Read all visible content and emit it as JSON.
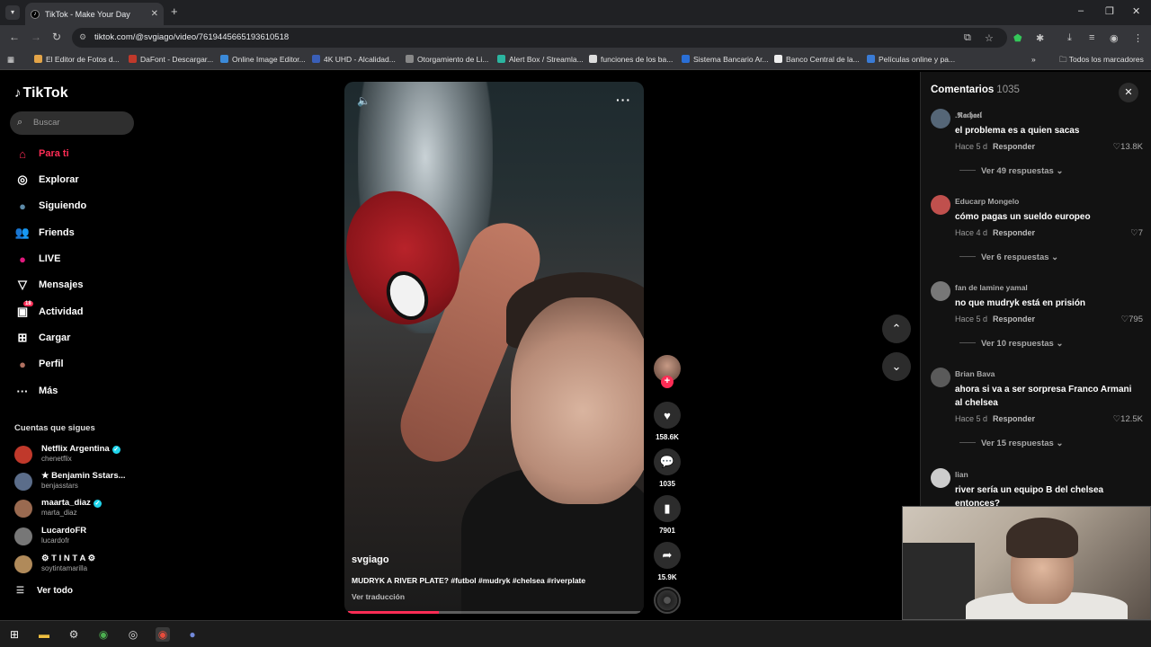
{
  "browser": {
    "tab_title": "TikTok - Make Your Day",
    "url": "tiktok.com/@svgiago/video/7619445665193610518",
    "bookmarks": [
      {
        "label": "El Editor de Fotos d...",
        "color": "#e3a448"
      },
      {
        "label": "DaFont - Descargar...",
        "color": "#c0392b"
      },
      {
        "label": "Online Image Editor...",
        "color": "#3b8ad9"
      },
      {
        "label": "4K UHD - Alcalidad...",
        "color": "#3a5fb8"
      },
      {
        "label": "Otorgamiento de Li...",
        "color": "#888888"
      },
      {
        "label": "Alert Box / Streamla...",
        "color": "#2bb5a0"
      },
      {
        "label": "funciones de los ba...",
        "color": "#dddddd"
      },
      {
        "label": "Sistema Bancario Ar...",
        "color": "#2a6fd6"
      },
      {
        "label": "Banco Central de la...",
        "color": "#eeeeee"
      },
      {
        "label": "Películas online y pa...",
        "color": "#3a7bd5"
      }
    ],
    "all_bookmarks": "Todos los marcadores"
  },
  "sidebar": {
    "logo": "TikTok",
    "search_placeholder": "Buscar",
    "nav": [
      {
        "label": "Para ti",
        "icon": "home-icon",
        "active": true
      },
      {
        "label": "Explorar",
        "icon": "compass-icon"
      },
      {
        "label": "Siguiendo",
        "icon": "following-avatar-icon"
      },
      {
        "label": "Friends",
        "icon": "friends-icon"
      },
      {
        "label": "LIVE",
        "icon": "live-icon"
      },
      {
        "label": "Mensajes",
        "icon": "send-icon"
      },
      {
        "label": "Actividad",
        "icon": "activity-icon",
        "badge": "18"
      },
      {
        "label": "Cargar",
        "icon": "upload-icon"
      },
      {
        "label": "Perfil",
        "icon": "profile-icon"
      },
      {
        "label": "Más",
        "icon": "more-icon"
      }
    ],
    "following_header": "Cuentas que sigues",
    "following": [
      {
        "name": "Netflix Argentina",
        "handle": "chenetflix",
        "verified": true,
        "color": "#c0392b"
      },
      {
        "name": "★ Benjamin Sstars...",
        "handle": "benjasstars",
        "verified": false,
        "color": "#5b6d8a"
      },
      {
        "name": "maarta_diaz",
        "handle": "marta_diaz",
        "verified": true,
        "color": "#9a6a50"
      },
      {
        "name": "LucardoFR",
        "handle": "lucardofr",
        "verified": false,
        "color": "#777777"
      },
      {
        "name": "⚙ T I N T A ⚙",
        "handle": "soytintamarilla",
        "verified": false,
        "color": "#b08a5a"
      }
    ],
    "see_all": "Ver todo"
  },
  "video": {
    "author": "svgiago",
    "caption": "MUDRYK A RIVER PLATE? #futbol #mudryk #chelsea #riverplate",
    "translate": "Ver traducción",
    "progress": 0.31,
    "likes": "158.6K",
    "comments": "1035",
    "saves": "7901",
    "shares": "15.9K"
  },
  "comments_panel": {
    "title": "Comentarios",
    "count": "1035",
    "reply_label": "Responder",
    "items": [
      {
        "user": ".𝕽𝖆𝖈𝖍𝖆𝖊𝖑",
        "text": "el problema es a quien sacas",
        "time": "Hace 5 d",
        "likes": "13.8K",
        "replies": "Ver 49 respuestas",
        "color": "#556677"
      },
      {
        "user": "Educarp Mongelo",
        "text": "cómo pagas un sueldo europeo",
        "time": "Hace 4 d",
        "likes": "7",
        "replies": "Ver 6 respuestas",
        "color": "#c0504d"
      },
      {
        "user": "fan de lamine yamal",
        "text": "no que mudryk está en prisión",
        "time": "Hace 5 d",
        "likes": "795",
        "replies": "Ver 10 respuestas",
        "color": "#777777"
      },
      {
        "user": "Brian Bava",
        "text": "ahora si va a ser sorpresa Franco Armani al chelsea",
        "time": "Hace 5 d",
        "likes": "12.5K",
        "replies": "Ver 15 respuestas",
        "color": "#5a5a5a"
      },
      {
        "user": "lian",
        "text": "river sería un equipo B del chelsea entonces?",
        "time": "",
        "likes": "",
        "replies": "",
        "color": "#cccccc"
      }
    ]
  }
}
